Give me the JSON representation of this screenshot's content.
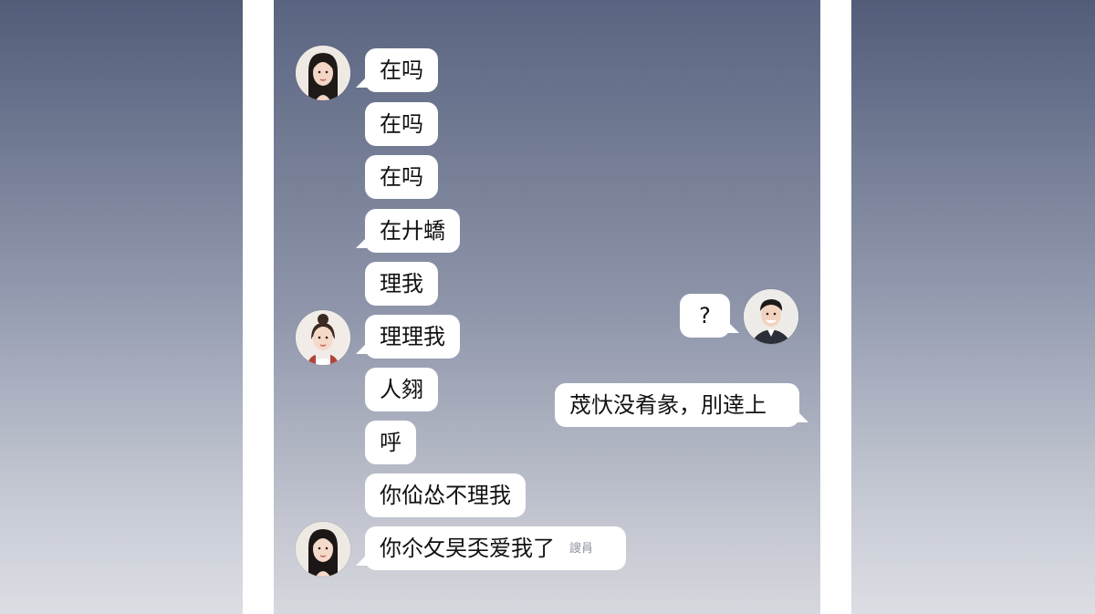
{
  "colors": {
    "bubble": "#ffffff",
    "frame": "#ffffff",
    "background_top": "#525c78",
    "background_bottom": "#dcdee4"
  },
  "avatars": [
    {
      "name": "girl-long-hair-avatar"
    },
    {
      "name": "girl-bun-hair-avatar"
    },
    {
      "name": "girl-long-hair-avatar-2"
    },
    {
      "name": "boy-suit-avatar"
    }
  ],
  "messages": [
    {
      "side": "left",
      "text": "在吗"
    },
    {
      "side": "left",
      "text": "在吗"
    },
    {
      "side": "left",
      "text": "在吗"
    },
    {
      "side": "left",
      "text": "在廾蟜"
    },
    {
      "side": "left",
      "text": "理我"
    },
    {
      "side": "left",
      "text": "理理我"
    },
    {
      "side": "left",
      "text": "人翗"
    },
    {
      "side": "left",
      "text": "呼"
    },
    {
      "side": "left",
      "text": "你佡怂不理我"
    },
    {
      "side": "left",
      "text": "你尒攵旲奀爱我了",
      "watermark": "謏肙"
    },
    {
      "side": "right",
      "text": "?"
    },
    {
      "side": "right",
      "text": "荗忕没肴彖，刖逹上"
    }
  ]
}
